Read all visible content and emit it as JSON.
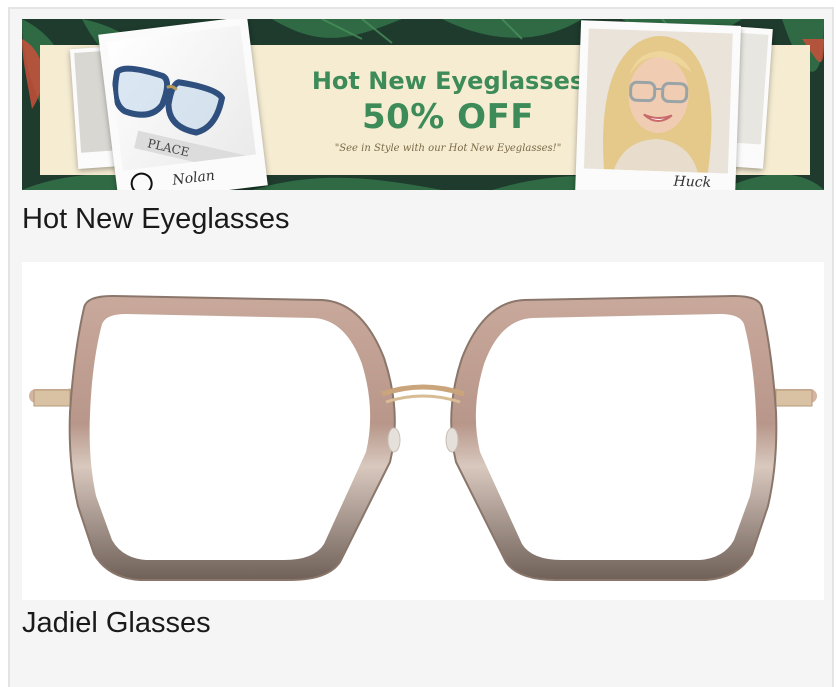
{
  "banner": {
    "headline": "Hot New Eyeglasses",
    "discount": "50% OFF",
    "tagline": "\"See in Style with our Hot New Eyeglasses!\"",
    "left_caption": "Nolan",
    "right_caption": "Huck",
    "colors": {
      "headline": "#3d8b59",
      "cream": "#f5ecd2",
      "leaves": "#1e3b2d"
    }
  },
  "cards": [
    {
      "title": "Hot New Eyeglasses"
    },
    {
      "title": "Jadiel Glasses"
    }
  ]
}
